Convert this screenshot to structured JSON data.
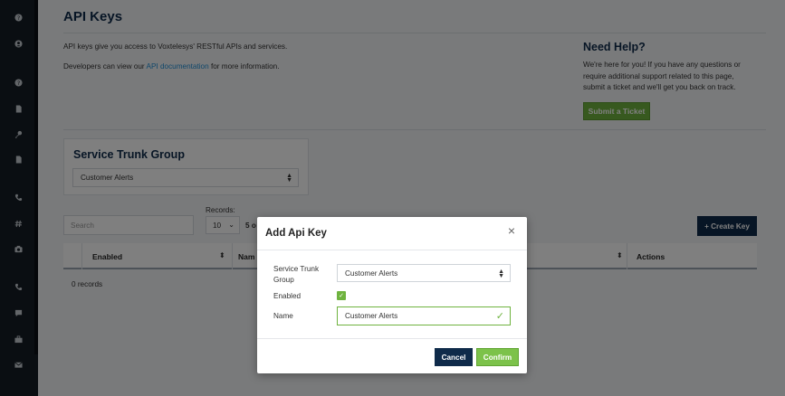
{
  "page": {
    "title": "API Keys",
    "intro_line1": "API keys give you access to Voxtelesys' RESTful APIs and services.",
    "intro_line2_prefix": "Developers can view our ",
    "intro_link": "API documentation",
    "intro_line2_suffix": " for more information."
  },
  "help": {
    "title": "Need Help?",
    "body": "We're here for you! If you have any questions or require additional support related to this page, submit a ticket and we'll get you back on track.",
    "button": "Submit a Ticket"
  },
  "service_trunk": {
    "title": "Service Trunk Group",
    "selected": "Customer Alerts"
  },
  "table_controls": {
    "search_placeholder": "Search",
    "records_label": "Records:",
    "records_value": "10",
    "records_of": "5 o",
    "create_button": "+ Create Key"
  },
  "table": {
    "columns": [
      "Enabled",
      "Nam",
      "Actions"
    ],
    "empty_text": "0 records"
  },
  "modal": {
    "title": "Add Api Key",
    "close": "×",
    "fields": {
      "stg_label": "Service Trunk Group",
      "stg_value": "Customer Alerts",
      "enabled_label": "Enabled",
      "enabled_checked": true,
      "name_label": "Name",
      "name_value": "Customer Alerts"
    },
    "cancel": "Cancel",
    "confirm": "Confirm"
  },
  "sidebar": {
    "icons": [
      "help-icon",
      "user-icon",
      "help-icon",
      "document-icon",
      "key-icon",
      "document-icon",
      "phone-icon",
      "hash-icon",
      "camera-icon",
      "phone-icon",
      "chat-icon",
      "briefcase-icon",
      "mail-icon"
    ]
  },
  "colors": {
    "navy": "#0f2b4a",
    "green": "#6fb33f",
    "link": "#1f8fd6",
    "sidebar": "#141c24"
  }
}
